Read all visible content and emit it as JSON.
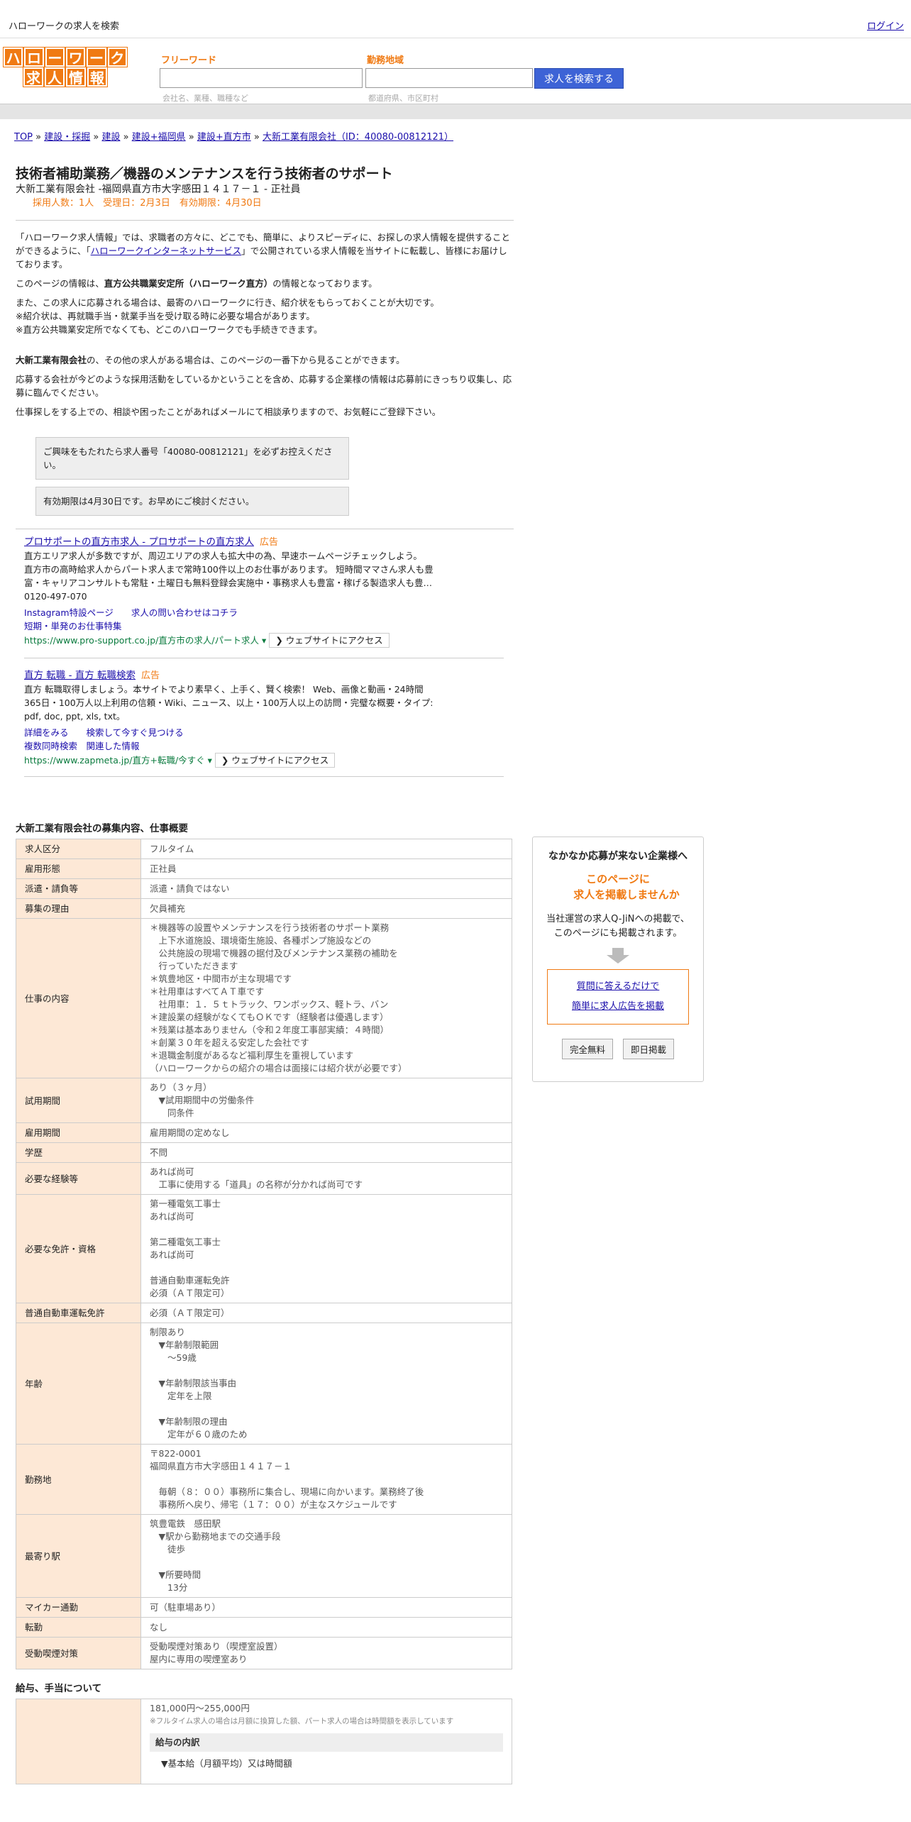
{
  "topbar": {
    "site_title": "ハローワークの求人を検索",
    "login": "ログイン"
  },
  "logo": {
    "row1": [
      "ハ",
      "ロ",
      "ー",
      "ワ",
      "ー",
      "ク"
    ],
    "row2": [
      "求",
      "人",
      "情",
      "報"
    ]
  },
  "search": {
    "freeword_label": "フリーワード",
    "freeword_placeholder": "会社名、業種、職種など",
    "area_label": "勤務地域",
    "area_placeholder": "都道府県、市区町村",
    "button": "求人を検索する"
  },
  "breadcrumb": [
    "TOP",
    "建設・採掘",
    "建設",
    "建設+福岡県",
    "建設+直方市",
    "大新工業有限会社（ID：40080-00812121）"
  ],
  "job": {
    "title": "技術者補助業務／機器のメンテナンスを行う技術者のサポート",
    "subtitle": "大新工業有限会社 -福岡県直方市大字感田１４１７－１ - 正社員",
    "meta": "採用人数：1人　受理日：2月3日　有効期限：4月30日"
  },
  "intro": {
    "p1a": "「ハローワーク求人情報」では、求職者の方々に、どこでも、簡単に、よりスピーディに、お探しの求人情報を提供することができるように、「",
    "p1link": "ハローワークインターネットサービス",
    "p1b": "」で公開されている求人情報を当サイトに転載し、皆様にお届けしております。",
    "p2a": "このページの情報は、",
    "p2b": "直方公共職業安定所（ハローワーク直方）",
    "p2c": "の情報となっております。",
    "p3": "また、この求人に応募される場合は、最寄のハローワークに行き、紹介状をもらっておくことが大切です。",
    "p4": "※紹介状は、再就職手当・就業手当を受け取る時に必要な場合があります。",
    "p5": "※直方公共職業安定所でなくても、どこのハローワークでも手続きできます。",
    "p6a": "大新工業有限会社",
    "p6b": "の、その他の求人がある場合は、このページの一番下から見ることができます。",
    "p7": "応募する会社が今どのような採用活動をしているかということを含め、応募する企業様の情報は応募前にきっちり収集し、応募に臨んでください。",
    "p8": "仕事探しをする上での、相談や困ったことがあればメールにて相談承りますので、お気軽にご登録下さい。"
  },
  "notices": [
    "ご興味をもたれたら求人番号「40080-00812121」を必ずお控えください。",
    "有効期限は4月30日です。お早めにご検討ください。"
  ],
  "ads": [
    {
      "title": "プロサポートの直方市求人 - プロサポートの直方求人",
      "tag": "広告",
      "lines": [
        "直方エリア求人が多数ですが、周辺エリアの求人も拡大中の為、早速ホームページチェックしよう。",
        "直方市の高時給求人からパート求人まで常時100件以上のお仕事があります。 短時間ママさん求人も豊",
        "富・キャリアコンサルトも常駐・土曜日も無料登録会実施中・事務求人も豊富・稼げる製造求人も豊…",
        "0120-497-070"
      ],
      "links": [
        "Instagram特設ページ",
        "求人の問い合わせはコチラ",
        "短期・単発のお仕事特集"
      ],
      "url": "https://www.pro-support.co.jp/直方市の求人/パート求人 ▾",
      "visit": "❯ ウェブサイトにアクセス"
    },
    {
      "title": "直方 転職 - 直方 転職検索",
      "tag": "広告",
      "lines": [
        "直方 転職取得しましょう。本サイトでより素早く、上手く、賢く検索！ Web、画像と動画・24時間",
        "365日・100万人以上利用の信頼・Wiki、ニュース、以上・100万人以上の訪問・完璧な概要・タイプ:",
        "pdf, doc, ppt, xls, txt。"
      ],
      "links": [
        "詳細をみる",
        "検索して今すぐ見つける",
        "複数同時検索",
        "関連した情報"
      ],
      "url": "https://www.zapmeta.jp/直方+転職/今すぐ ▾",
      "visit": "❯ ウェブサイトにアクセス"
    }
  ],
  "section1_title": "大新工業有限会社の募集内容、仕事概要",
  "table": [
    {
      "k": "求人区分",
      "v": [
        "フルタイム"
      ]
    },
    {
      "k": "雇用形態",
      "v": [
        "正社員"
      ]
    },
    {
      "k": "派遣・請負等",
      "v": [
        "派遣・請負ではない"
      ]
    },
    {
      "k": "募集の理由",
      "v": [
        "欠員補充"
      ]
    },
    {
      "k": "仕事の内容",
      "v": [
        "＊機器等の設置やメンテナンスを行う技術者のサポート業務",
        "　上下水道施設、環境衛生施設、各種ポンプ施設などの",
        "　公共施設の現場で機器の据付及びメンテナンス業務の補助を",
        "　行っていただきます",
        "＊筑豊地区・中間市が主な現場です",
        "＊社用車はすべてＡＴ車です",
        "　社用車：１．５ｔトラック、ワンボックス、軽トラ、バン",
        "＊建設業の経験がなくてもＯＫです（経験者は優遇します）",
        "＊残業は基本ありません（令和２年度工事部実績：４時間）",
        "＊創業３０年を超える安定した会社です",
        "＊退職金制度があるなど福利厚生を重視しています",
        "（ハローワークからの紹介の場合は面接には紹介状が必要です）"
      ]
    },
    {
      "k": "試用期間",
      "v": [
        "あり（３ヶ月）",
        "　▼試用期間中の労働条件",
        "　　同条件"
      ]
    },
    {
      "k": "雇用期間",
      "v": [
        "雇用期間の定めなし"
      ]
    },
    {
      "k": "学歴",
      "v": [
        "不問"
      ]
    },
    {
      "k": "必要な経験等",
      "v": [
        "あれば尚可",
        "　工事に使用する「道具」の名称が分かれば尚可です"
      ]
    },
    {
      "k": "必要な免許・資格",
      "v": [
        "第一種電気工事士",
        "あれば尚可",
        "",
        "第二種電気工事士",
        "あれば尚可",
        "",
        "普通自動車運転免許",
        "必須（ＡＴ限定可）"
      ]
    },
    {
      "k": "普通自動車運転免許",
      "v": [
        "必須（ＡＴ限定可）"
      ]
    },
    {
      "k": "年齢",
      "v": [
        "制限あり",
        "　▼年齢制限範囲",
        "　　〜59歳",
        "",
        "　▼年齢制限該当事由",
        "　　定年を上限",
        "",
        "　▼年齢制限の理由",
        "　　定年が６０歳のため"
      ]
    },
    {
      "k": "勤務地",
      "v": [
        "〒822-0001",
        "福岡県直方市大字感田１４１７－１",
        "",
        "　毎朝（８：００）事務所に集合し、現場に向かいます。業務終了後",
        "　事務所へ戻り、帰宅（１７：００）が主なスケジュールです"
      ]
    },
    {
      "k": "最寄り駅",
      "v": [
        "筑豊電鉄　感田駅",
        "　▼駅から勤務地までの交通手段",
        "　　徒歩",
        "",
        "　▼所要時間",
        "　　13分"
      ]
    },
    {
      "k": "マイカー通勤",
      "v": [
        "可（駐車場あり）"
      ]
    },
    {
      "k": "転勤",
      "v": [
        "なし"
      ]
    },
    {
      "k": "受動喫煙対策",
      "v": [
        "受動喫煙対策あり（喫煙室設置）",
        "屋内に専用の喫煙室あり"
      ]
    }
  ],
  "section2_title": "給与、手当について",
  "salary": {
    "range": "181,000円〜255,000円",
    "note": "※フルタイム求人の場合は月額に換算した額、パート求人の場合は時間額を表示しています",
    "breakdown_title": "給与の内訳",
    "item": "▼基本給（月額平均）又は時間額"
  },
  "sidebar": {
    "title": "なかなか応募が来ない企業様へ",
    "catch1": "このページに",
    "catch2": "求人を掲載しませんか",
    "desc1": "当社運営の求人Q-JiNへの掲載で、",
    "desc2": "このページにも掲載されます。",
    "link1": "質問に答えるだけで",
    "link2": "簡単に求人広告を掲載",
    "btn1": "完全無料",
    "btn2": "即日掲載"
  },
  "colors": {
    "accent": "#f07a13",
    "button": "#3d63d6",
    "link": "#1a0dab",
    "th_bg": "#fde8d6"
  }
}
